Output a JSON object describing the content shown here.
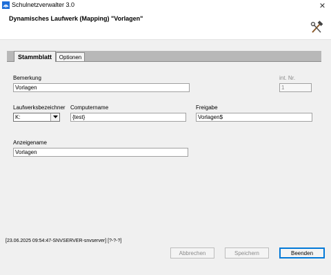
{
  "window": {
    "title": "Schulnetzverwalter 3.0",
    "close_symbol": "✕"
  },
  "header": {
    "title": "Dynamisches Laufwerk (Mapping) \"Vorlagen\""
  },
  "tabs": [
    {
      "label": "Stammblatt",
      "active": true
    },
    {
      "label": "Optionen",
      "active": false
    }
  ],
  "form": {
    "bemerkung": {
      "label": "Bemerkung",
      "value": "Vorlagen"
    },
    "int_nr": {
      "label": "int. Nr.",
      "value": "1"
    },
    "laufwerk": {
      "label": "Laufwerksbezeichner",
      "value": "K:"
    },
    "computername": {
      "label": "Computername",
      "value": "{test}"
    },
    "freigabe": {
      "label": "Freigabe",
      "value": "Vorlagen$"
    },
    "anzeigename": {
      "label": "Anzeigename",
      "value": "Vorlagen"
    }
  },
  "status_text": "[23.06.2025 09:54:47-SNVSERVER-snvserver] [?-?-?]",
  "buttons": {
    "abbrechen": "Abbrechen",
    "speichern": "Speichern",
    "beenden": "Beenden"
  },
  "icons": {
    "app": "network-app-icon",
    "tools": "hammer-wrench-icon"
  },
  "colors": {
    "primary_border": "#0078d7",
    "content_bg": "#f0f0f0"
  }
}
